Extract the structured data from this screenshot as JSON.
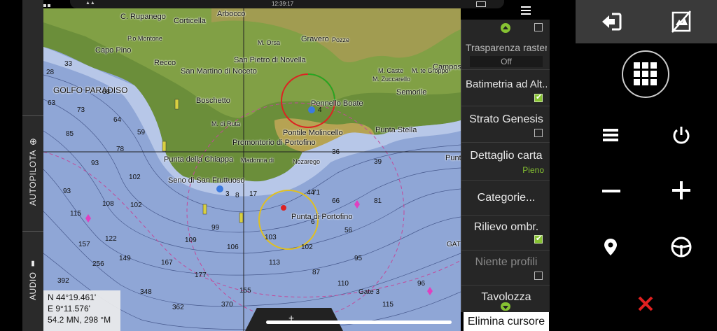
{
  "status_bar": {
    "time": "12:39:17"
  },
  "left_rail": {
    "autopilot_label": "AUTOPILOTA",
    "audio_label": "AUDIO"
  },
  "map": {
    "place_labels": [
      "C. Rupanego",
      "Corticella",
      "Arbocco",
      "Capo Pino",
      "P.o Montone",
      "Recco",
      "M. Orsa",
      "Gravero",
      "Pozze",
      "San Pietro di Novella",
      "San Martino di Noceto",
      "GOLFO PARADISO",
      "Boschetto",
      "Pennello Boate",
      "Campos",
      "M. Caste",
      "M. te Groppo",
      "M. Zuccarello",
      "Semorile",
      "M. di Ruta",
      "Pontile Molincello",
      "Promontorio di Portofino",
      "Punta Stella",
      "Punta della Chiappa",
      "Madonna di",
      "Nozarego",
      "Seno di San Fruttuoso",
      "Dettaglio",
      "Punta di Portofino",
      "Gate 3",
      "Punta Chi",
      "GAT"
    ],
    "depth_values": [
      "33",
      "28",
      "68",
      "63",
      "73",
      "64",
      "85",
      "59",
      "78",
      "93",
      "102",
      "93",
      "115",
      "108",
      "102",
      "157",
      "122",
      "109",
      "99",
      "256",
      "149",
      "167",
      "106",
      "392",
      "348",
      "177",
      "362",
      "370",
      "155",
      "103",
      "113",
      "102",
      "71",
      "66",
      "56",
      "81",
      "95",
      "87",
      "110",
      "115",
      "96",
      "36",
      "39",
      "44",
      "17",
      "3",
      "8",
      "4",
      "6"
    ]
  },
  "coord_box": {
    "lat": "N  44°19.461'",
    "lon": "E  9°11.576'",
    "range": "54.2 MN, 298 °M"
  },
  "side_panel": {
    "items": [
      {
        "label": "Trasparenza raster",
        "value": "Off"
      },
      {
        "label": "Batimetria ad Alt...",
        "checked": true
      },
      {
        "label": "Strato Genesis",
        "checked": false
      },
      {
        "label": "Dettaglio carta",
        "value": "Pieno"
      },
      {
        "label": "Categorie..."
      },
      {
        "label": "Rilievo ombr.",
        "checked": true
      },
      {
        "label": "Niente profili",
        "checked": false
      },
      {
        "label": "Tavolozza"
      }
    ],
    "accent_green": "#86c232",
    "delete_cursor_label": "Elimina cursore"
  },
  "controls": {
    "icons": [
      "exit-icon",
      "map-off-icon",
      "grid-menu-icon",
      "menu-icon",
      "power-icon",
      "zoom-out-icon",
      "zoom-in-icon",
      "waypoint-icon",
      "steering-wheel-icon",
      "close-icon"
    ]
  }
}
